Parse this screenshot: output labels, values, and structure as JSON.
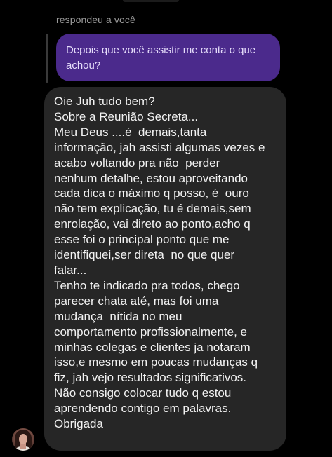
{
  "thread": {
    "reply_label": "respondeu a você"
  },
  "quoted_message": {
    "lines": [
      "Depois que você assistir me conta o que",
      "achou?"
    ]
  },
  "message": {
    "lines": [
      "Oie Juh tudo bem?",
      "Sobre a Reunião Secreta...",
      "Meu Deus ....é  demais,tanta",
      "informação, jah assisti algumas vezes e",
      "acabo voltando pra não  perder",
      "nenhum detalhe, estou aproveitando",
      "cada dica o máximo q posso, é  ouro",
      "não tem explicação, tu é demais,sem",
      "enrolação, vai direto ao ponto,acho q",
      "esse foi o principal ponto que me",
      "identifiquei,ser direta  no que quer",
      "falar...",
      "Tenho te indicado pra todos, chego",
      "parecer chata até, mas foi uma",
      "mudança  nítida no meu",
      "comportamento profissionalmente, e",
      "minhas colegas e clientes ja notaram",
      "isso,e mesmo em poucas mudanças q",
      "fiz, jah vejo resultados significativos.",
      "Não consigo colocar tudo q estou",
      "aprendendo contigo em palavras.",
      "Obrigada"
    ]
  },
  "colors": {
    "background": "#000000",
    "quoted_bubble": "#4b2a8c",
    "message_bubble": "#262626",
    "reply_label": "#9a9a9a"
  }
}
